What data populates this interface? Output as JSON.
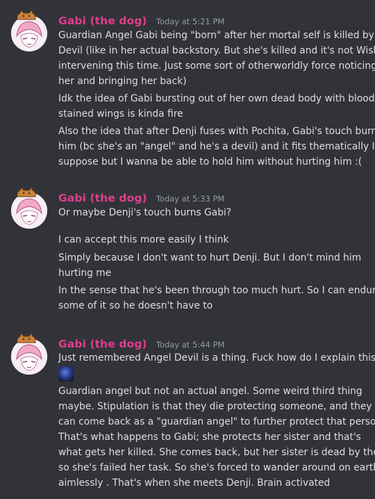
{
  "messages": [
    {
      "username": "Gabi (the dog)",
      "timestamp": "Today at 5:21 PM",
      "lines": [
        "Guardian Angel Gabi being \"born\" after her mortal self is killed by a",
        "Devil (like in her actual backstory. But she's killed and it's not Wishi",
        "intervening this time. Just some sort of otherworldly force noticing",
        "her and bringing her back)",
        "Idk the idea of Gabi bursting out of her own dead body with blood",
        "stained wings is kinda fire",
        "Also the idea that after Denji fuses with Pochita, Gabi's touch burn",
        "him (bc she's an \"angel\" and he's a devil) and it fits thematically I",
        "suppose but I wanna be able to hold him without hurting him :("
      ]
    },
    {
      "username": "Gabi (the dog)",
      "timestamp": "Today at 5:33 PM",
      "lines": [
        "Or maybe Denji's touch burns Gabi?",
        "I can accept this more easily I think",
        "Simply because I don't want to hurt Denji. But I don't mind him",
        "hurting me",
        "In the sense that he's been through too much hurt. So I can endure",
        "some of it so he doesn't have to"
      ]
    },
    {
      "username": "Gabi (the dog)",
      "timestamp": "Today at 5:44 PM",
      "lines": [
        "Just remembered Angel Devil is a thing. Fuck how do I explain this",
        "Guardian angel but not an actual angel. Some weird third thing",
        "maybe. Stipulation is that they die protecting someone, and they",
        "can come back as a \"guardian angel\" to further protect that person.",
        "That's what happens to Gabi; she protects her sister and that's",
        "what gets her killed. She comes back, but her sister is dead by then,",
        "so she's failed her task. So she's forced to wander around on earth",
        "aimlessly . That's when she meets Denji. Brain activated"
      ],
      "emoji": "custom-emoji"
    }
  ]
}
